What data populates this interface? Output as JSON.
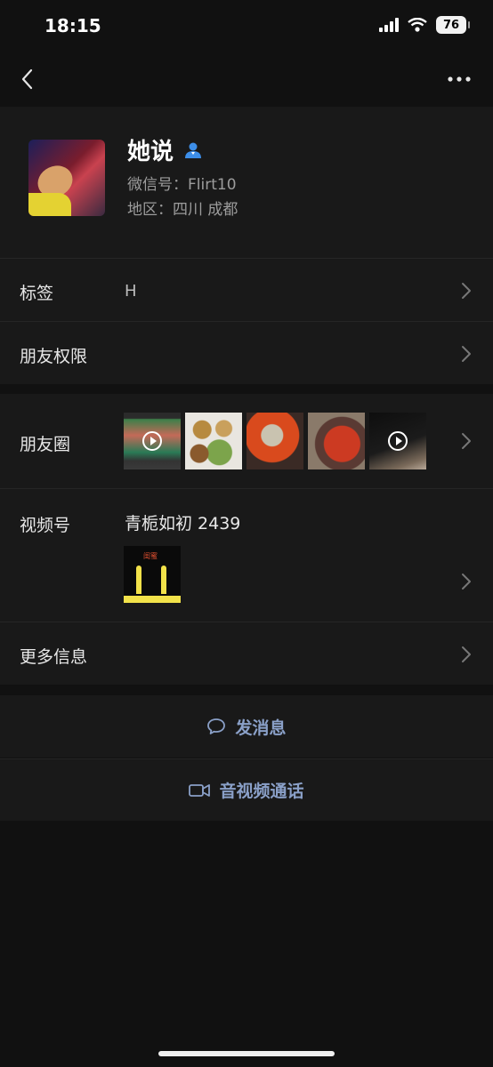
{
  "status_bar": {
    "time": "18:15",
    "battery": "76"
  },
  "nav": {
    "back_icon": "chevron-left-icon",
    "more_icon": "ellipsis-icon"
  },
  "profile": {
    "name": "她说",
    "wechat_id": "微信号：Flirt10",
    "region": "地区：四川 成都",
    "badge_icon": "person-icon",
    "badge_color": "#3d8ee8"
  },
  "rows": {
    "tags": {
      "label": "标签",
      "value": "H"
    },
    "permissions": {
      "label": "朋友权限"
    },
    "moments": {
      "label": "朋友圈"
    },
    "channels": {
      "label": "视频号",
      "value": "青栀如初 2439",
      "thumb_text": "闺蜜"
    },
    "more_info": {
      "label": "更多信息"
    }
  },
  "actions": {
    "send_message": "发消息",
    "av_call": "音视频通话",
    "accent_color": "#8aa0c8"
  }
}
